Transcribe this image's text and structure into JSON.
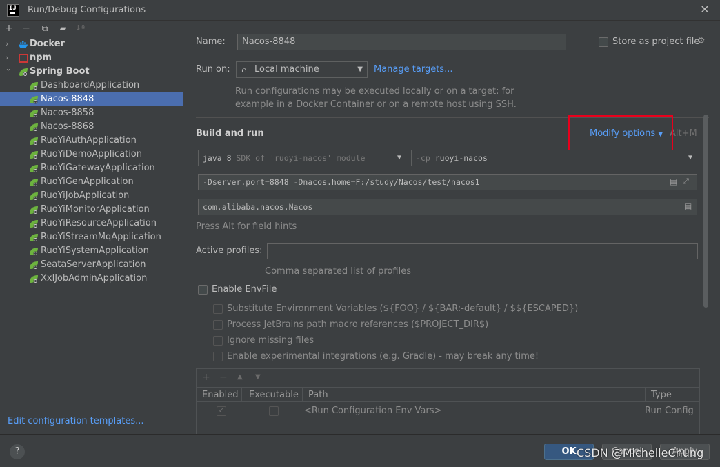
{
  "window": {
    "title": "Run/Debug Configurations",
    "icon_text": "IJ"
  },
  "left_toolbar": {
    "add": "+",
    "remove": "−",
    "copy": "⧉",
    "folder": "▰",
    "sort": "↓ª"
  },
  "tree": {
    "groups": [
      {
        "label": "Docker",
        "expanded": false
      },
      {
        "label": "npm",
        "expanded": false
      },
      {
        "label": "Spring Boot",
        "expanded": true
      }
    ],
    "items": [
      {
        "label": "DashboardApplication"
      },
      {
        "label": "Nacos-8848",
        "selected": true
      },
      {
        "label": "Nacos-8858"
      },
      {
        "label": "Nacos-8868"
      },
      {
        "label": "RuoYiAuthApplication"
      },
      {
        "label": "RuoYiDemoApplication"
      },
      {
        "label": "RuoYiGatewayApplication"
      },
      {
        "label": "RuoYiGenApplication"
      },
      {
        "label": "RuoYiJobApplication"
      },
      {
        "label": "RuoYiMonitorApplication"
      },
      {
        "label": "RuoYiResourceApplication"
      },
      {
        "label": "RuoYiStreamMqApplication"
      },
      {
        "label": "RuoYiSystemApplication"
      },
      {
        "label": "SeataServerApplication"
      },
      {
        "label": "XxlJobAdminApplication"
      }
    ],
    "edit_templates": "Edit configuration templates..."
  },
  "form": {
    "name_label": "Name:",
    "name_value": "Nacos-8848",
    "store_label": "Store as project file",
    "run_on_label": "Run on:",
    "run_on_value": "Local machine",
    "manage_targets": "Manage targets...",
    "run_hint_1": "Run configurations may be executed locally or on a target: for",
    "run_hint_2": "example in a Docker Container or on a remote host using SSH.",
    "build_and_run": "Build and run",
    "modify_options": "Modify options",
    "modify_shortcut": "Alt+M",
    "jdk_value": "java 8",
    "jdk_hint": "SDK of 'ruoyi-nacos' module",
    "cp_prefix": "-cp",
    "cp_value": "ruoyi-nacos",
    "vm_options": "-Dserver.port=8848 -Dnacos.home=F:/study/Nacos/test/nacos1",
    "main_class": "com.alibaba.nacos.Nacos",
    "field_hint": "Press Alt for field hints",
    "active_profiles_label": "Active profiles:",
    "active_profiles_value": "",
    "profiles_hint": "Comma separated list of profiles",
    "enable_envfile": "Enable EnvFile",
    "env_options": [
      "Substitute Environment Variables (${FOO} / ${BAR:-default} / $${ESCAPED})",
      "Process JetBrains path macro references ($PROJECT_DIR$)",
      "Ignore missing files",
      "Enable experimental integrations (e.g. Gradle) - may break any time!"
    ]
  },
  "env_table": {
    "toolbar": {
      "add": "+",
      "remove": "−",
      "up": "▲",
      "down": "▼"
    },
    "columns": [
      "Enabled",
      "Executable",
      "Path",
      "Type"
    ],
    "rows": [
      {
        "enabled": true,
        "executable": false,
        "path": "<Run Configuration Env Vars>",
        "type": "Run Config"
      }
    ]
  },
  "footer": {
    "help": "?",
    "ok": "OK",
    "cancel": "Cancel",
    "apply": "Apply",
    "watermark": "CSDN @MichelleChung"
  },
  "colors": {
    "accent": "#589df6",
    "selection": "#4b6eaf",
    "highlight_box": "#e8001c",
    "spring": "#6db33f",
    "docker": "#2496ed",
    "npm": "#cb3837"
  }
}
